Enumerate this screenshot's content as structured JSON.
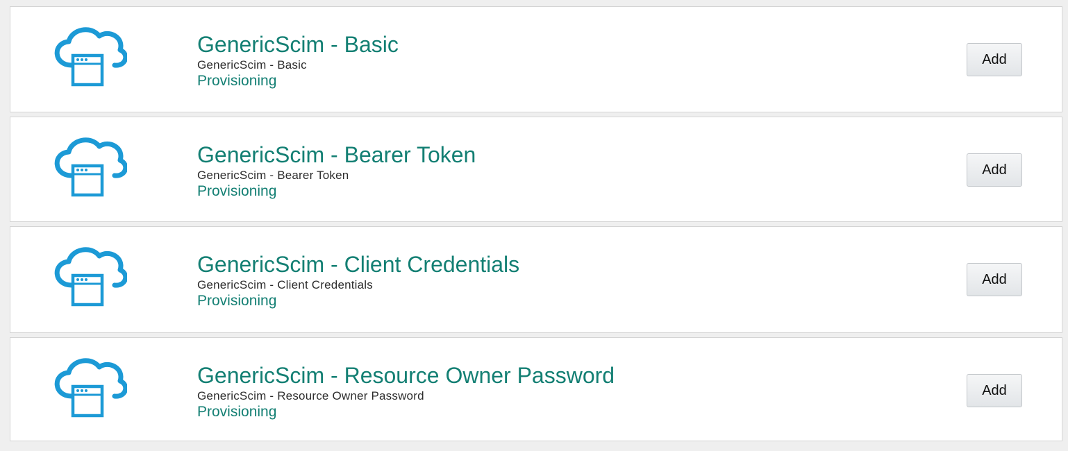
{
  "colors": {
    "accent": "#137f73",
    "icon": "#1c9ad6",
    "background": "#efefef",
    "card": "#ffffff"
  },
  "apps": [
    {
      "icon": "cloud-app-icon",
      "title": "GenericScim - Basic",
      "subtitle": "GenericScim - Basic",
      "category": "Provisioning",
      "button": "Add"
    },
    {
      "icon": "cloud-app-icon",
      "title": "GenericScim - Bearer Token",
      "subtitle": "GenericScim - Bearer Token",
      "category": "Provisioning",
      "button": "Add"
    },
    {
      "icon": "cloud-app-icon",
      "title": "GenericScim - Client Credentials",
      "subtitle": "GenericScim - Client Credentials",
      "category": "Provisioning",
      "button": "Add"
    },
    {
      "icon": "cloud-app-icon",
      "title": "GenericScim - Resource Owner Password",
      "subtitle": "GenericScim - Resource Owner Password",
      "category": "Provisioning",
      "button": "Add"
    }
  ]
}
